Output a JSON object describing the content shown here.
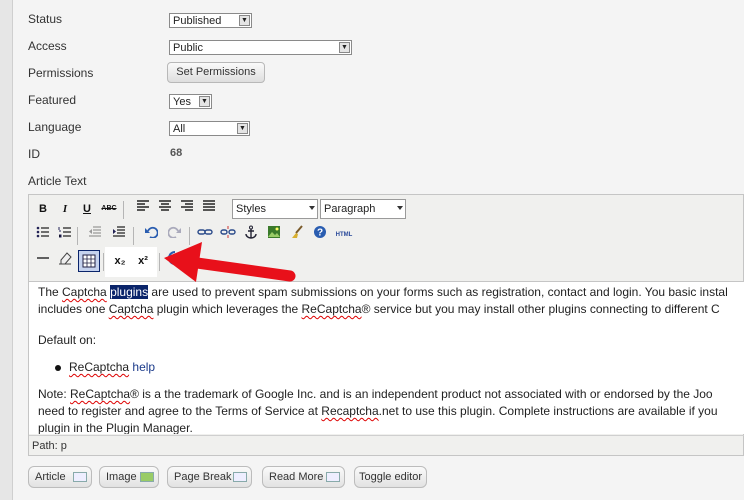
{
  "form": {
    "status": {
      "label": "Status",
      "value": "Published"
    },
    "access": {
      "label": "Access",
      "value": "Public"
    },
    "permissions": {
      "label": "Permissions",
      "button": "Set Permissions"
    },
    "featured": {
      "label": "Featured",
      "value": "Yes"
    },
    "language": {
      "label": "Language",
      "value": "All"
    },
    "id": {
      "label": "ID",
      "value": "68"
    },
    "article_text_label": "Article Text"
  },
  "editor": {
    "toolbar1": {
      "bold": "B",
      "italic": "I",
      "underline": "U",
      "strike": "ABC",
      "styles": "Styles",
      "format": "Paragraph"
    },
    "toolbar3": {
      "subscript": "x₂",
      "superscript": "x²"
    },
    "html_label": "HTML",
    "content": {
      "line1_a": "The ",
      "line1_captcha": "Captcha",
      "line1_sel": "plugins",
      "line1_b": " are used to prevent spam submissions on your forms such as registration, contact and login. You basic instal",
      "line2_a": "includes one ",
      "line2_captcha": "Captcha",
      "line2_b": " plugin which leverages the ",
      "line2_recaptcha": "ReCaptcha",
      "line2_c": "® service but you may install other plugins connecting to different C",
      "default_on": "Default on:",
      "bullet_recaptcha": "ReCaptcha",
      "bullet_help": "help",
      "note_a": "Note: ",
      "note_recaptcha": "ReCaptcha",
      "note_b": "® is a the trademark of Google Inc. and is an independent product not associated with or endorsed by the Joo",
      "note2_a": "need to register and agree to the Terms of Service at ",
      "note2_site": "Recaptcha",
      "note2_b": ".net to use this plugin. Complete instructions are available if you",
      "note3": "plugin in the Plugin Manager."
    },
    "path": "Path: p"
  },
  "bottom_buttons": {
    "article": "Article",
    "image": "Image",
    "page_break": "Page Break",
    "read_more": "Read More",
    "toggle": "Toggle editor"
  },
  "colors": {
    "selection": "#0a246a",
    "arrow": "#e8101a",
    "link": "#1a3a8a"
  }
}
